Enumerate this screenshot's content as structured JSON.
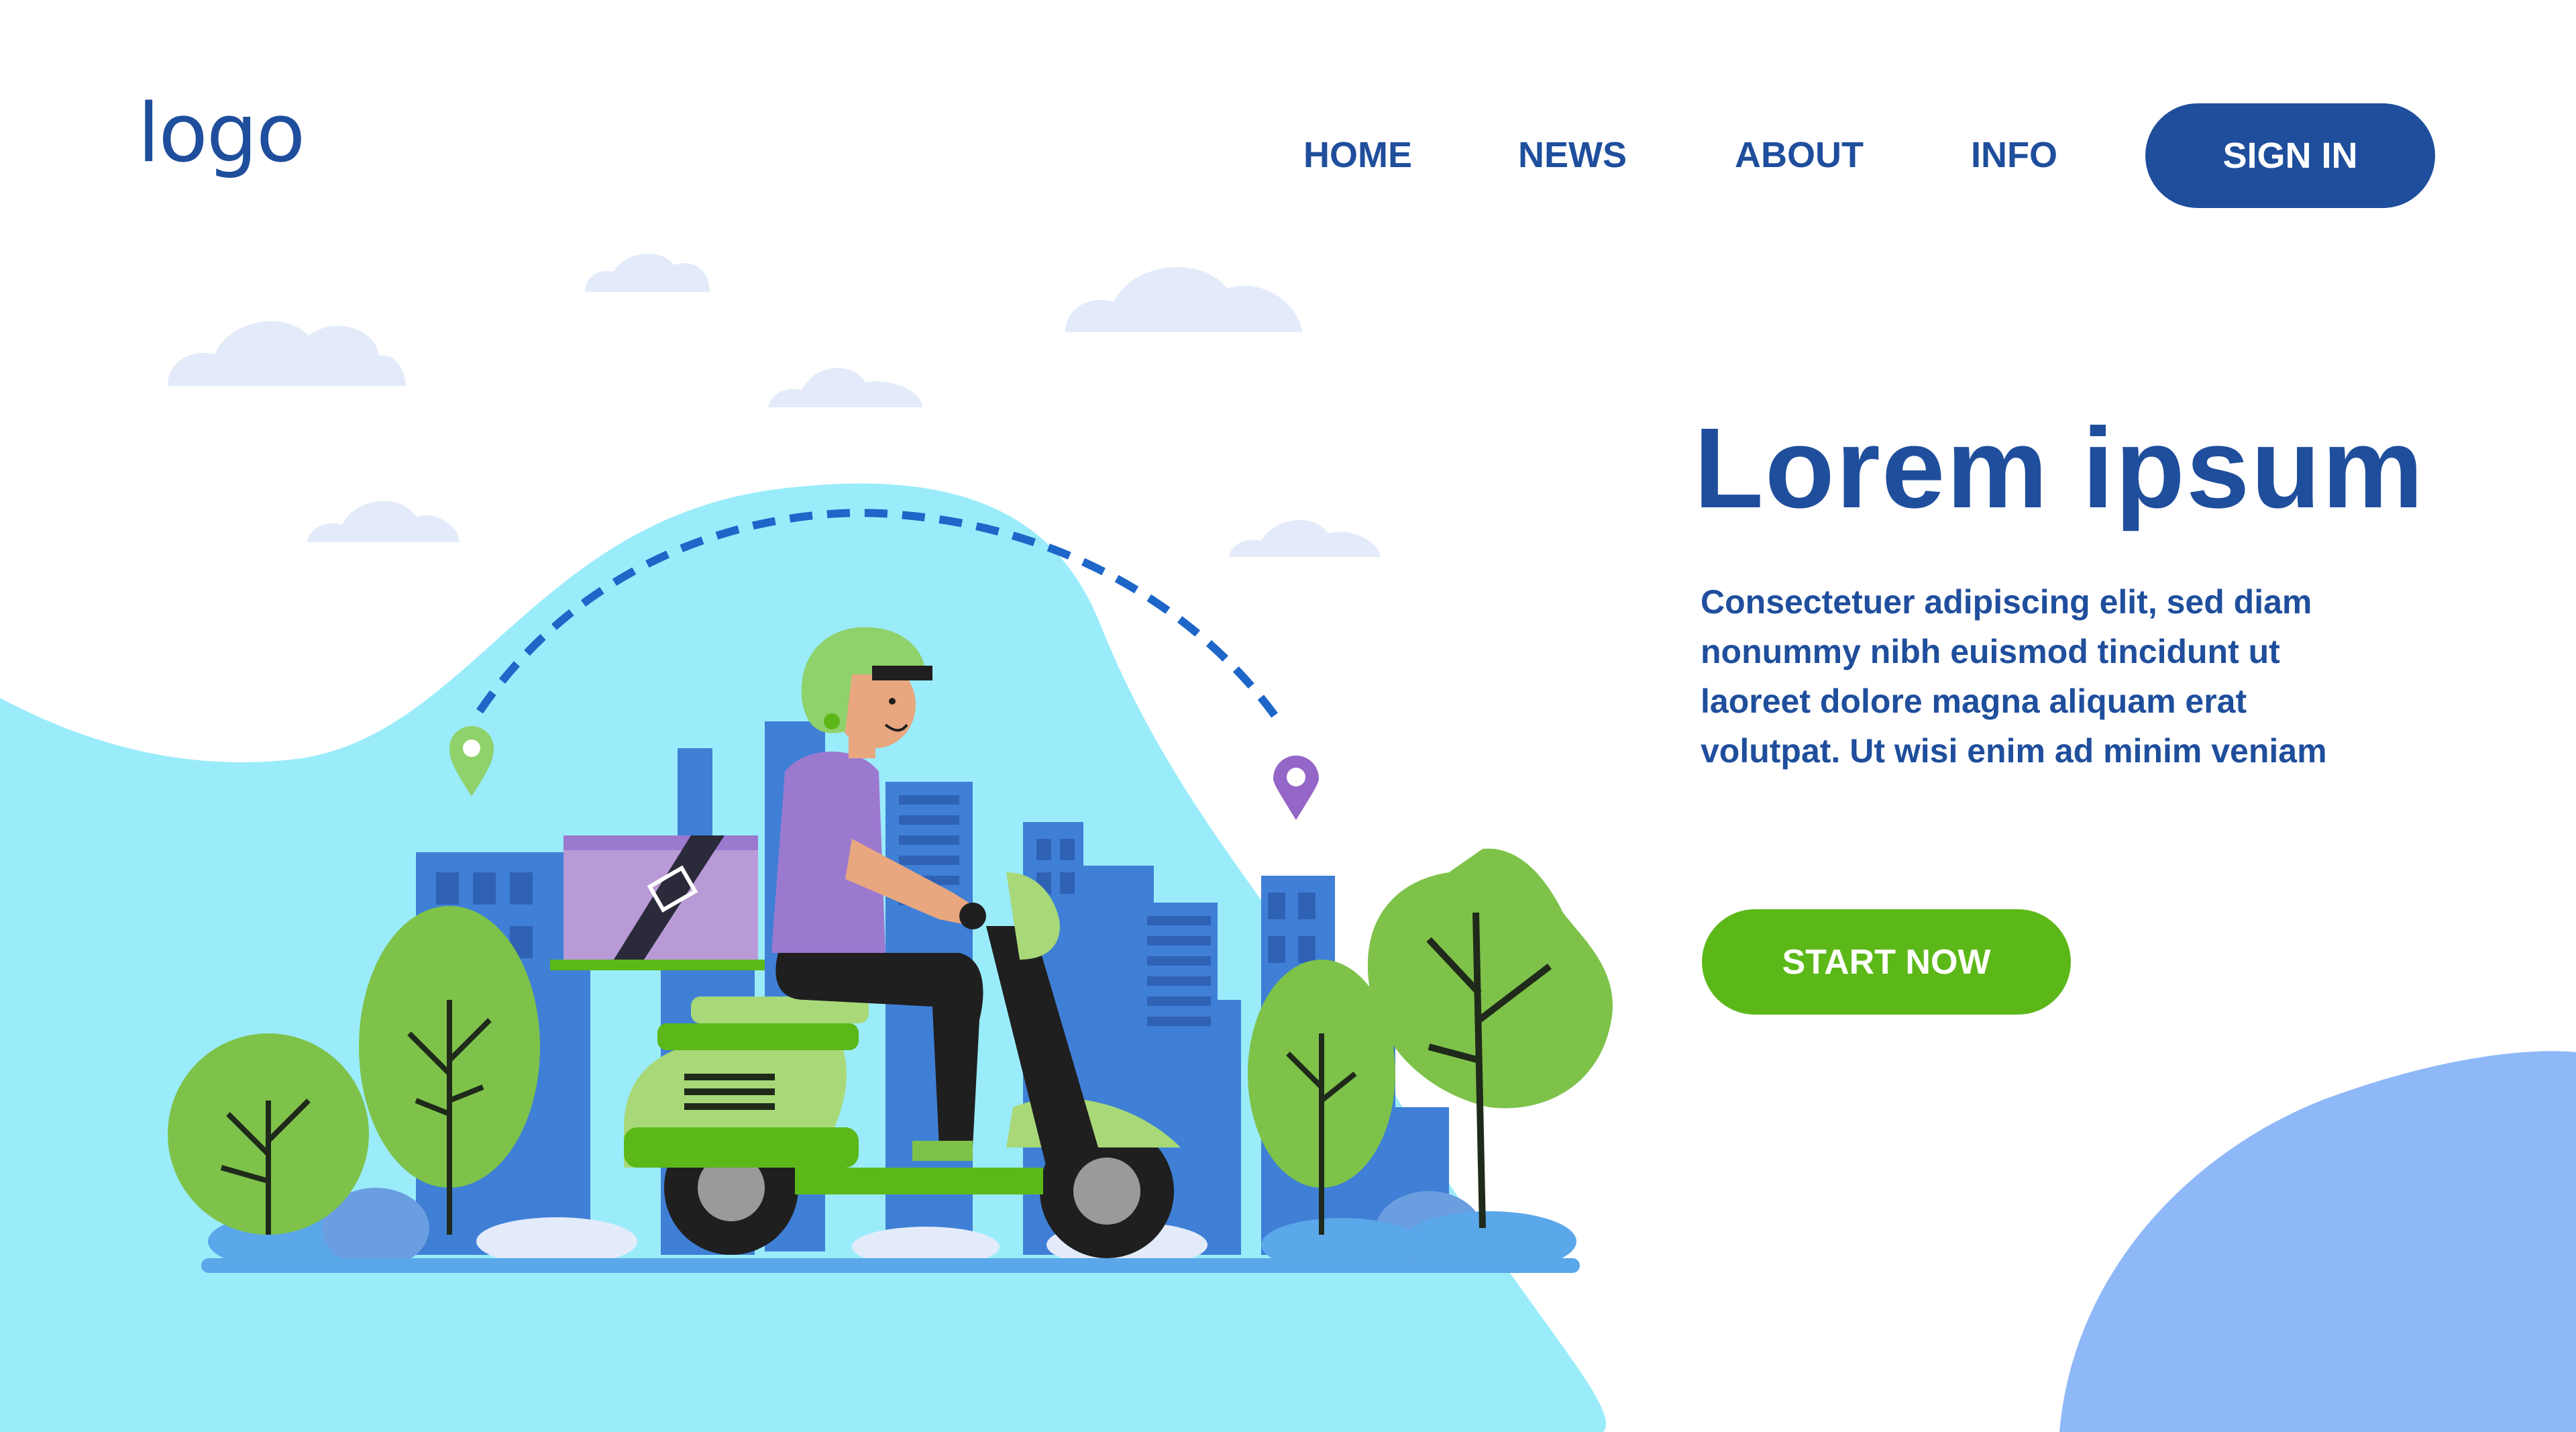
{
  "header": {
    "logo_text": "logo",
    "nav": [
      "HOME",
      "NEWS",
      "ABOUT",
      "INFO"
    ],
    "sign_in_label": "SIGN IN"
  },
  "hero": {
    "title": "Lorem ipsum",
    "body_lines": [
      "Consectetuer adipiscing elit, sed diam",
      "nonummy nibh euismod tincidunt ut",
      "laoreet dolore magna aliquam erat",
      "volutpat. Ut wisi enim ad minim veniam"
    ],
    "cta_label": "START NOW"
  },
  "illustration": {
    "subject": "delivery courier riding scooter through city",
    "icons": [
      "location-pin-icon",
      "location-pin-icon"
    ]
  },
  "colors": {
    "brand_blue": "#1f4e9c",
    "accent_green": "#5cb818",
    "blob_cyan": "#9aecfb",
    "blob_blue": "#8fb8f8",
    "city_blue": "#3f7fd6",
    "cloud": "#e3ebfa",
    "tree_green": "#7ec24a",
    "shirt_purple": "#9b79cf",
    "box_purple": "#b89ad6",
    "pin_green": "#8fd16a",
    "pin_purple": "#9466c7"
  }
}
